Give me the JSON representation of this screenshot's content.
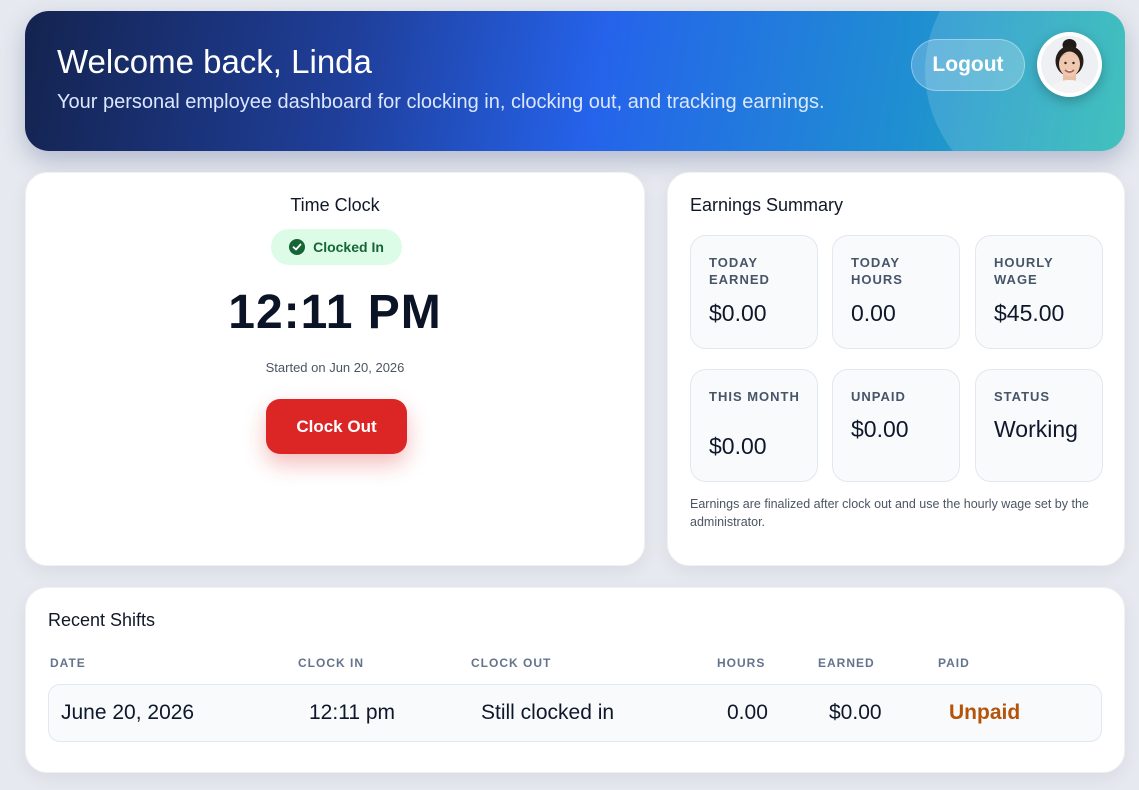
{
  "header": {
    "title": "Welcome back, Linda",
    "subtitle": "Your personal employee dashboard for clocking in, clocking out, and tracking earnings.",
    "logout_label": "Logout"
  },
  "time_clock": {
    "title": "Time Clock",
    "status": "Clocked In",
    "time": "12:11 PM",
    "started": "Started on Jun 20, 2026",
    "button_label": "Clock Out"
  },
  "earnings": {
    "title": "Earnings Summary",
    "stats": [
      {
        "label": "Today Earned",
        "value": "$0.00"
      },
      {
        "label": "Today Hours",
        "value": "0.00"
      },
      {
        "label": "Hourly Wage",
        "value": "$45.00"
      },
      {
        "label": "This Month",
        "value": "$0.00"
      },
      {
        "label": "Unpaid",
        "value": "$0.00"
      },
      {
        "label": "Status",
        "value": "Working"
      }
    ],
    "note": "Earnings are finalized after clock out and use the hourly wage set by the administrator."
  },
  "shifts": {
    "title": "Recent Shifts",
    "columns": [
      "Date",
      "Clock In",
      "Clock Out",
      "Hours",
      "Earned",
      "Paid"
    ],
    "rows": [
      {
        "date": "June 20, 2026",
        "clock_in": "12:11 pm",
        "clock_out": "Still clocked in",
        "hours": "0.00",
        "earned": "$0.00",
        "paid": "Unpaid"
      }
    ]
  },
  "colors": {
    "accent": "#2563eb",
    "clock_out": "#dc2626",
    "status_green": "#166534",
    "unpaid": "#b45309"
  },
  "icons": {
    "status": "check-circle-icon",
    "avatar": "user-avatar"
  }
}
